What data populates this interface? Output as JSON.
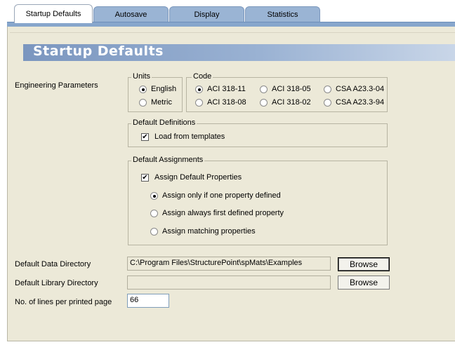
{
  "tabs": [
    {
      "label": "Startup Defaults",
      "active": true
    },
    {
      "label": "Autosave",
      "active": false
    },
    {
      "label": "Display",
      "active": false
    },
    {
      "label": "Statistics",
      "active": false
    }
  ],
  "banner": {
    "title": "Startup Defaults"
  },
  "engineering": {
    "label": "Engineering Parameters",
    "units": {
      "legend": "Units",
      "options": [
        "English",
        "Metric"
      ],
      "selected": "English"
    },
    "code": {
      "legend": "Code",
      "options": [
        "ACI 318-11",
        "ACI 318-05",
        "CSA A23.3-04",
        "ACI 318-08",
        "ACI 318-02",
        "CSA A23.3-94"
      ],
      "selected": "ACI 318-11"
    }
  },
  "definitions": {
    "legend": "Default Definitions",
    "load_templates": "Load from templates",
    "load_templates_checked": true
  },
  "assignments": {
    "legend": "Default Assignments",
    "assign_default": "Assign Default Properties",
    "assign_default_checked": true,
    "options": [
      "Assign only if one property defined",
      "Assign always first defined property",
      "Assign matching properties"
    ],
    "selected": "Assign only if one property defined"
  },
  "data_directory": {
    "label": "Default Data Directory",
    "value": "C:\\Program Files\\StructurePoint\\spMats\\Examples",
    "button": "Browse"
  },
  "library_directory": {
    "label": "Default Library Directory",
    "value": "",
    "button": "Browse"
  },
  "lines_per_page": {
    "label": "No. of lines per printed page",
    "value": "66"
  },
  "colors": {
    "tab_bar": "#87a6cc",
    "panel": "#ece9d8",
    "banner_start": "#7b96bf"
  }
}
